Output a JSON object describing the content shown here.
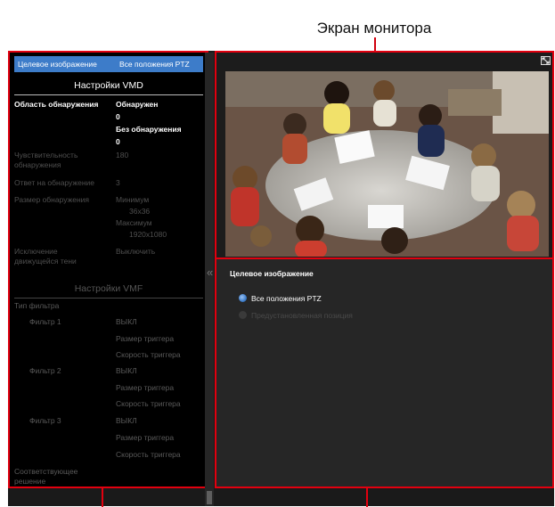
{
  "callout": {
    "title": "Экран монитора"
  },
  "left": {
    "target_label": "Целевое изображение",
    "target_value": "Все положения PTZ",
    "vmd_heading": "Настройки VMD",
    "detection_area_label": "Область обнаружения",
    "detected_label": "Обнаружен",
    "detected_value": "0",
    "not_detected_label": "Без обнаружения",
    "not_detected_value": "0",
    "sensitivity_label": "Чувствительность обнаружения",
    "sensitivity_value": "180",
    "response_label": "Ответ на обнаружение",
    "response_value": "3",
    "size_label": "Размер обнаружения",
    "min_label": "Минимум",
    "min_value": "36x36",
    "max_label": "Максимум",
    "max_value": "1920x1080",
    "shadow_label": "Исключение движущейся тени",
    "shadow_value": "Выключить",
    "vmf_heading": "Настройки VMF",
    "filter_type_label": "Тип фильтра",
    "filters": [
      {
        "name": "Фильтр 1",
        "state": "ВЫКЛ",
        "size": "Размер триггера",
        "speed": "Скорость триггера"
      },
      {
        "name": "Фильтр 2",
        "state": "ВЫКЛ",
        "size": "Размер триггера",
        "speed": "Скорость триггера"
      },
      {
        "name": "Фильтр 3",
        "state": "ВЫКЛ",
        "size": "Размер триггера",
        "speed": "Скорость триггера"
      }
    ],
    "matching_label": "Соответствующее решение"
  },
  "right": {
    "heading": "Целевое изображение",
    "option_all": "Все положения PTZ",
    "option_preset": "Предустановленная позиция"
  },
  "colors": {
    "accent_red": "#e2000f",
    "selection_blue": "#3d7cc9"
  },
  "icons": {
    "fullscreen": "fullscreen-icon",
    "collapse": "double-chevron-left-icon"
  }
}
